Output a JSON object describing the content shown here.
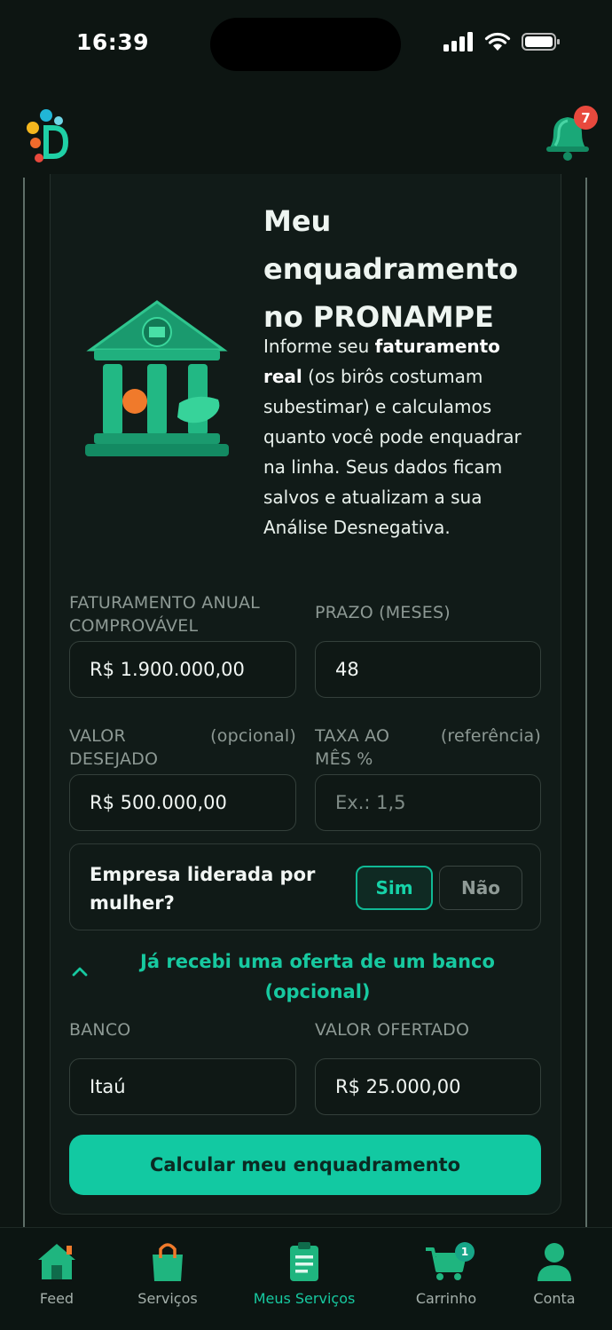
{
  "status_bar": {
    "time": "16:39"
  },
  "header": {
    "notifications_count": "7"
  },
  "card": {
    "title": "Meu enquadramento no PRONAMPE",
    "desc_parts": [
      "Informe seu ",
      "faturamento real",
      " (os birôs costumam subestimar) e calculamos quanto você pode enquadrar na linha. Seus dados ficam salvos e atualizam a sua Análise Desnegativa."
    ]
  },
  "form": {
    "faturamento": {
      "label": "FATURAMENTO ANUAL COMPROVÁVEL",
      "value": "R$ 1.900.000,00"
    },
    "prazo": {
      "label": "PRAZO (MESES)",
      "value": "48"
    },
    "valor": {
      "label": "VALOR DESEJADO",
      "optional": "(opcional)",
      "value": "R$ 500.000,00"
    },
    "taxa": {
      "label": "TAXA AO MÊS %",
      "optional": "(referência)",
      "placeholder": "Ex.: 1,5"
    },
    "mulher": {
      "label": "Empresa liderada por mulher?",
      "yes": "Sim",
      "no": "Não",
      "selected": "Sim"
    },
    "offer_toggle": "Já recebi uma oferta de um banco (opcional)",
    "banco": {
      "label": "BANCO",
      "value": "Itaú"
    },
    "valor_ofertado": {
      "label": "VALOR OFERTADO",
      "value": "R$ 25.000,00"
    },
    "submit": "Calcular meu enquadramento"
  },
  "nav": {
    "items": [
      {
        "label": "Feed",
        "icon": "house-icon"
      },
      {
        "label": "Serviços",
        "icon": "shopping-bag-icon"
      },
      {
        "label": "Meus Serviços",
        "icon": "clipboard-icon",
        "active": true
      },
      {
        "label": "Carrinho",
        "icon": "cart-icon",
        "badge": "1"
      },
      {
        "label": "Conta",
        "icon": "user-icon"
      }
    ]
  },
  "colors": {
    "accent": "#12c9a2",
    "background": "#0d1512",
    "card": "#111b18",
    "badge": "#e8493d"
  }
}
